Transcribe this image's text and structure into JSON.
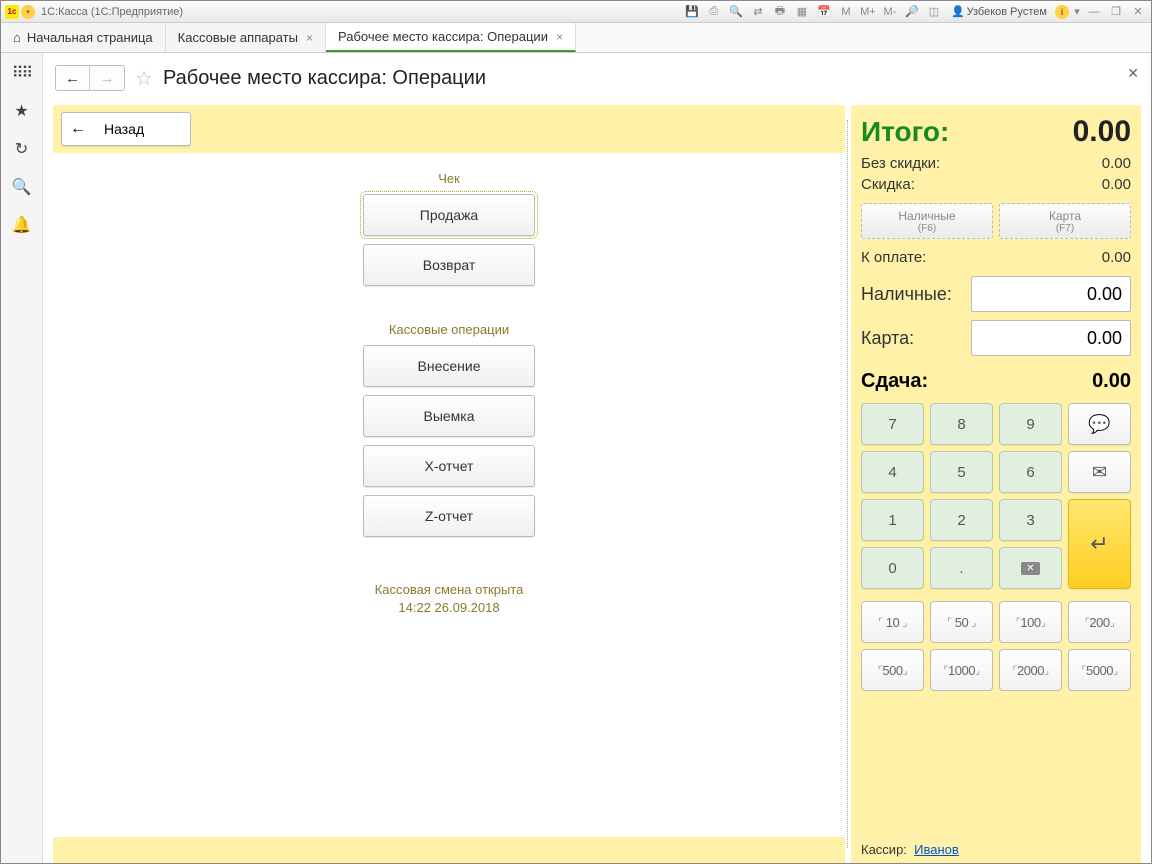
{
  "titlebar": {
    "title": "1С:Касса  (1С:Предприятие)",
    "user": "Узбеков Рустем"
  },
  "tabs": {
    "home": "Начальная страница",
    "t1": "Кассовые аппараты",
    "t2": "Рабочее место кассира: Операции"
  },
  "page": {
    "title": "Рабочее место кассира: Операции"
  },
  "back": "Назад",
  "sections": {
    "check": "Чек",
    "cashops": "Кассовые операции"
  },
  "ops": {
    "sale": "Продажа",
    "return": "Возврат",
    "deposit": "Внесение",
    "withdraw": "Выемка",
    "xreport": "X-отчет",
    "zreport": "Z-отчет"
  },
  "status": {
    "line1": "Кассовая смена открыта",
    "line2": "14:22 26.09.2018"
  },
  "totals": {
    "total_label": "Итого:",
    "total": "0.00",
    "nodiscount_label": "Без скидки:",
    "nodiscount": "0.00",
    "discount_label": "Скидка:",
    "discount": "0.00",
    "cash_btn": "Наличные",
    "cash_btn_sub": "(F6)",
    "card_btn": "Карта",
    "card_btn_sub": "(F7)",
    "topay_label": "К оплате:",
    "topay": "0.00",
    "cash_label": "Наличные:",
    "cash_val": "0.00",
    "card_label": "Карта:",
    "card_val": "0.00",
    "change_label": "Сдача:",
    "change": "0.00"
  },
  "keypad": {
    "k7": "7",
    "k8": "8",
    "k9": "9",
    "k4": "4",
    "k5": "5",
    "k6": "6",
    "k1": "1",
    "k2": "2",
    "k3": "3",
    "k0": "0",
    "kdot": "."
  },
  "presets": {
    "p10": "10",
    "p50": "50",
    "p100": "100",
    "p200": "200",
    "p500": "500",
    "p1000": "1000",
    "p2000": "2000",
    "p5000": "5000"
  },
  "cashier": {
    "label": "Кассир:",
    "name": "Иванов"
  }
}
